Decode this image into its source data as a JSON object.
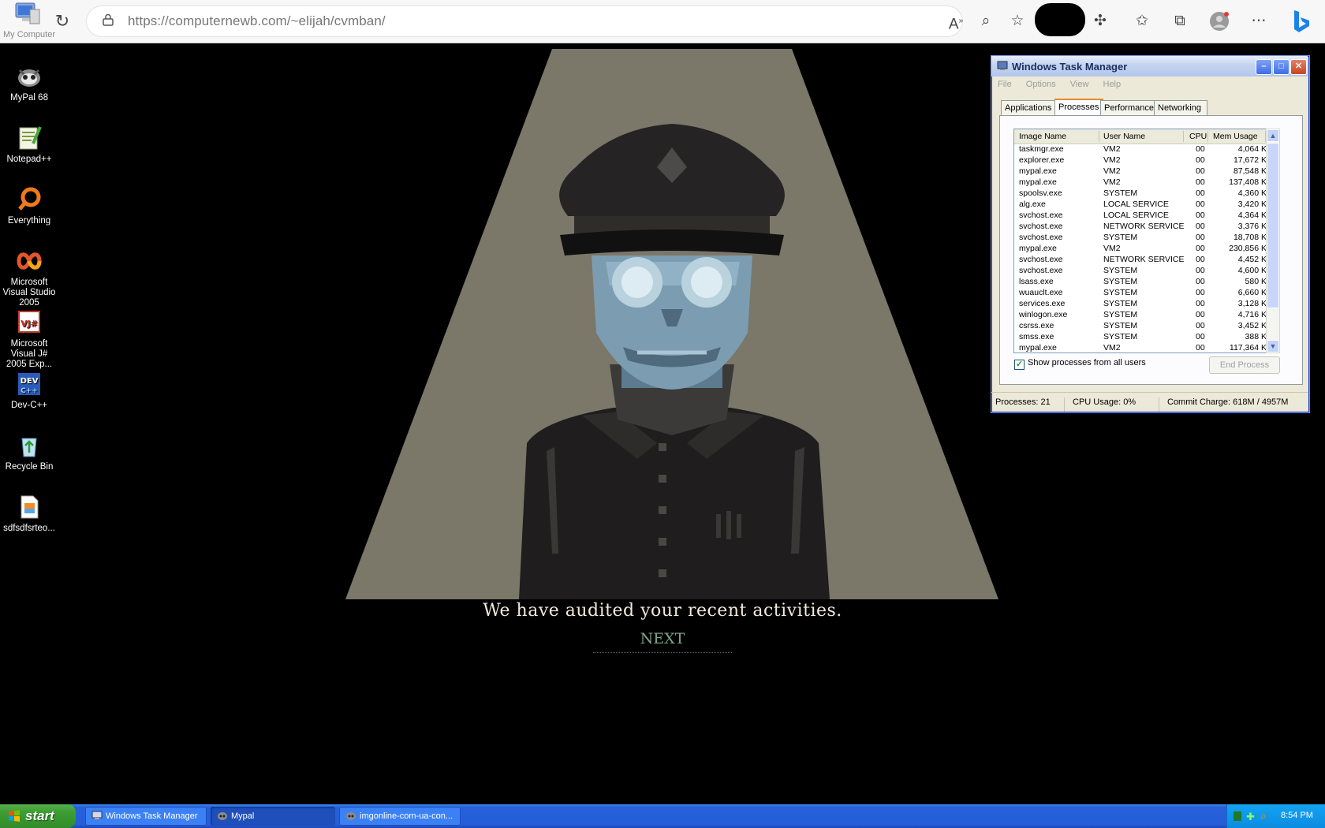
{
  "browser": {
    "url_host": "https://computernewb.com",
    "url_path": "/~elijah/cvmban/"
  },
  "desktop": {
    "icons": [
      {
        "label": "My Computer"
      },
      {
        "label": "MyPal 68"
      },
      {
        "label": "Notepad++"
      },
      {
        "label": "Everything"
      },
      {
        "label": "Microsoft Visual Studio 2005"
      },
      {
        "label": "Microsoft Visual J# 2005 Exp..."
      },
      {
        "label": "Dev-C++"
      },
      {
        "label": "Recycle Bin"
      },
      {
        "label": "sdfsdfsrteo..."
      }
    ]
  },
  "game": {
    "caption": "We have audited your recent activities.",
    "next_label": "NEXT"
  },
  "task_manager": {
    "title": "Windows Task Manager",
    "menu": [
      "File",
      "Options",
      "View",
      "Help"
    ],
    "tabs": [
      "Applications",
      "Processes",
      "Performance",
      "Networking"
    ],
    "active_tab": "Processes",
    "columns": [
      "Image Name",
      "User Name",
      "CPU",
      "Mem Usage"
    ],
    "processes": [
      [
        "taskmgr.exe",
        "VM2",
        "00",
        "4,064 K"
      ],
      [
        "explorer.exe",
        "VM2",
        "00",
        "17,672 K"
      ],
      [
        "mypal.exe",
        "VM2",
        "00",
        "87,548 K"
      ],
      [
        "mypal.exe",
        "VM2",
        "00",
        "137,408 K"
      ],
      [
        "spoolsv.exe",
        "SYSTEM",
        "00",
        "4,360 K"
      ],
      [
        "alg.exe",
        "LOCAL SERVICE",
        "00",
        "3,420 K"
      ],
      [
        "svchost.exe",
        "LOCAL SERVICE",
        "00",
        "4,364 K"
      ],
      [
        "svchost.exe",
        "NETWORK SERVICE",
        "00",
        "3,376 K"
      ],
      [
        "svchost.exe",
        "SYSTEM",
        "00",
        "18,708 K"
      ],
      [
        "mypal.exe",
        "VM2",
        "00",
        "230,856 K"
      ],
      [
        "svchost.exe",
        "NETWORK SERVICE",
        "00",
        "4,452 K"
      ],
      [
        "svchost.exe",
        "SYSTEM",
        "00",
        "4,600 K"
      ],
      [
        "lsass.exe",
        "SYSTEM",
        "00",
        "580 K"
      ],
      [
        "wuauclt.exe",
        "SYSTEM",
        "00",
        "6,660 K"
      ],
      [
        "services.exe",
        "SYSTEM",
        "00",
        "3,128 K"
      ],
      [
        "winlogon.exe",
        "SYSTEM",
        "00",
        "4,716 K"
      ],
      [
        "csrss.exe",
        "SYSTEM",
        "00",
        "3,452 K"
      ],
      [
        "smss.exe",
        "SYSTEM",
        "00",
        "388 K"
      ],
      [
        "mypal.exe",
        "VM2",
        "00",
        "117,364 K"
      ]
    ],
    "show_all_label": "Show processes from all users",
    "end_process_label": "End Process",
    "status": {
      "processes": "Processes: 21",
      "cpu": "CPU Usage: 0%",
      "commit": "Commit Charge: 618M / 4957M"
    }
  },
  "taskbar": {
    "start_label": "start",
    "tasks": [
      "Windows Task Manager",
      "Mypal",
      "imgonline-com-ua-con..."
    ],
    "clock": "8:54 PM"
  }
}
